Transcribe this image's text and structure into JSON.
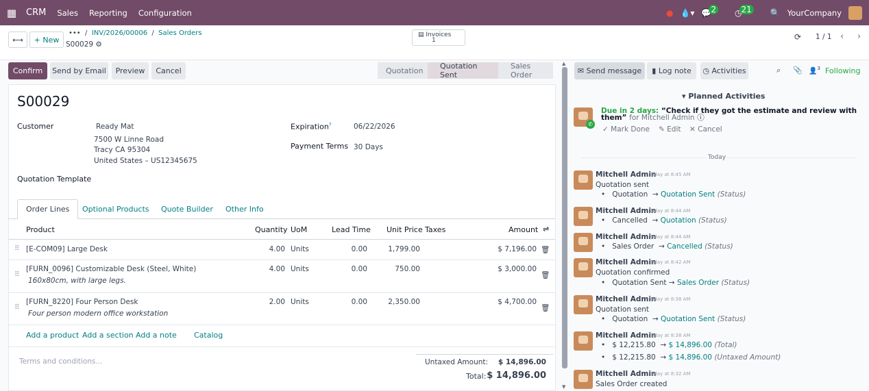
{
  "topnav": {
    "brand": "CRM",
    "menus": [
      "Sales",
      "Reporting",
      "Configuration"
    ],
    "badge_messages": "2",
    "badge_activities": "21",
    "company": "YourCompany"
  },
  "control": {
    "new_label": "New",
    "breadcrumb_parent": "INV/2026/00006",
    "breadcrumb_list": "Sales Orders",
    "record_name": "S00029",
    "invoices_label": "Invoices",
    "invoices_count": "1",
    "pager": "1 / 1"
  },
  "actions": {
    "confirm": "Confirm",
    "send_email": "Send by Email",
    "preview": "Preview",
    "cancel": "Cancel"
  },
  "statusbar": [
    "Quotation",
    "Quotation Sent",
    "Sales Order"
  ],
  "form": {
    "title": "S00029",
    "customer_label": "Customer",
    "customer_name": "Ready Mat",
    "address1": "7500 W Linne Road",
    "address2": "Tracy CA 95304",
    "address3": "United States – US12345675",
    "expiration_label": "Expiration",
    "expiration_help": "?",
    "expiration_value": "06/22/2026",
    "payment_terms_label": "Payment Terms",
    "payment_terms_value": "30 Days",
    "quotation_template_label": "Quotation Template"
  },
  "tabs": [
    "Order Lines",
    "Optional Products",
    "Quote Builder",
    "Other Info"
  ],
  "table": {
    "headers": {
      "product": "Product",
      "quantity": "Quantity",
      "uom": "UoM",
      "lead_time": "Lead Time",
      "unit_price": "Unit Price",
      "taxes": "Taxes",
      "amount": "Amount"
    },
    "rows": [
      {
        "product": "[E-COM09] Large Desk",
        "description": "",
        "quantity": "4.00",
        "uom": "Units",
        "lead_time": "0.00",
        "unit_price": "1,799.00",
        "amount": "$ 7,196.00"
      },
      {
        "product": "[FURN_0096] Customizable Desk (Steel, White)",
        "description": "160x80cm, with large legs.",
        "quantity": "4.00",
        "uom": "Units",
        "lead_time": "0.00",
        "unit_price": "750.00",
        "amount": "$ 3,000.00"
      },
      {
        "product": "[FURN_8220] Four Person Desk",
        "description": "Four person modern office workstation",
        "quantity": "2.00",
        "uom": "Units",
        "lead_time": "0.00",
        "unit_price": "2,350.00",
        "amount": "$ 4,700.00"
      }
    ],
    "add_product": "Add a product",
    "add_section": "Add a section",
    "add_note": "Add a note",
    "catalog": "Catalog"
  },
  "footer": {
    "terms_placeholder": "Terms and conditions...",
    "untaxed_label": "Untaxed Amount:",
    "untaxed_value": "$ 14,896.00",
    "total_label": "Total:",
    "total_value": "$ 14,896.00"
  },
  "chatter": {
    "send_message": "Send message",
    "log_note": "Log note",
    "activities": "Activities",
    "followers_count": "3",
    "following": "Following",
    "planned_title": "Planned Activities",
    "due": "Due in 2 days:",
    "activity_summary": "“Check if they got the estimate and review with them”",
    "activity_for": "for Mitchell Admin",
    "mark_done": "Mark Done",
    "edit": "Edit",
    "cancel": "Cancel",
    "today": "Today",
    "messages": [
      {
        "author": "Mitchell Admin",
        "time": "Today at 8:45 AM",
        "body": "Quotation sent",
        "tracks": [
          {
            "from": "Quotation",
            "to": "Quotation Sent",
            "field": "(Status)"
          }
        ]
      },
      {
        "author": "Mitchell Admin",
        "time": "Today at 8:44 AM",
        "body": "",
        "tracks": [
          {
            "from": "Cancelled",
            "to": "Quotation",
            "field": "(Status)"
          }
        ]
      },
      {
        "author": "Mitchell Admin",
        "time": "Today at 8:44 AM",
        "body": "",
        "tracks": [
          {
            "from": "Sales Order",
            "to": "Cancelled",
            "field": "(Status)"
          }
        ]
      },
      {
        "author": "Mitchell Admin",
        "time": "Today at 8:42 AM",
        "body": "Quotation confirmed",
        "tracks": [
          {
            "from": "Quotation Sent",
            "to": "Sales Order",
            "field": "(Status)"
          }
        ]
      },
      {
        "author": "Mitchell Admin",
        "time": "Today at 8:38 AM",
        "body": "Quotation sent",
        "tracks": [
          {
            "from": "Quotation",
            "to": "Quotation Sent",
            "field": "(Status)"
          }
        ]
      },
      {
        "author": "Mitchell Admin",
        "time": "Today at 8:38 AM",
        "body": "",
        "tracks": [
          {
            "from": "$ 12,215.80",
            "to": "$ 14,896.00",
            "field": "(Total)"
          },
          {
            "from": "$ 12,215.80",
            "to": "$ 14,896.00",
            "field": "(Untaxed Amount)"
          }
        ]
      },
      {
        "author": "Mitchell Admin",
        "time": "Today at 8:32 AM",
        "body": "Sales Order created",
        "tracks": []
      }
    ]
  }
}
